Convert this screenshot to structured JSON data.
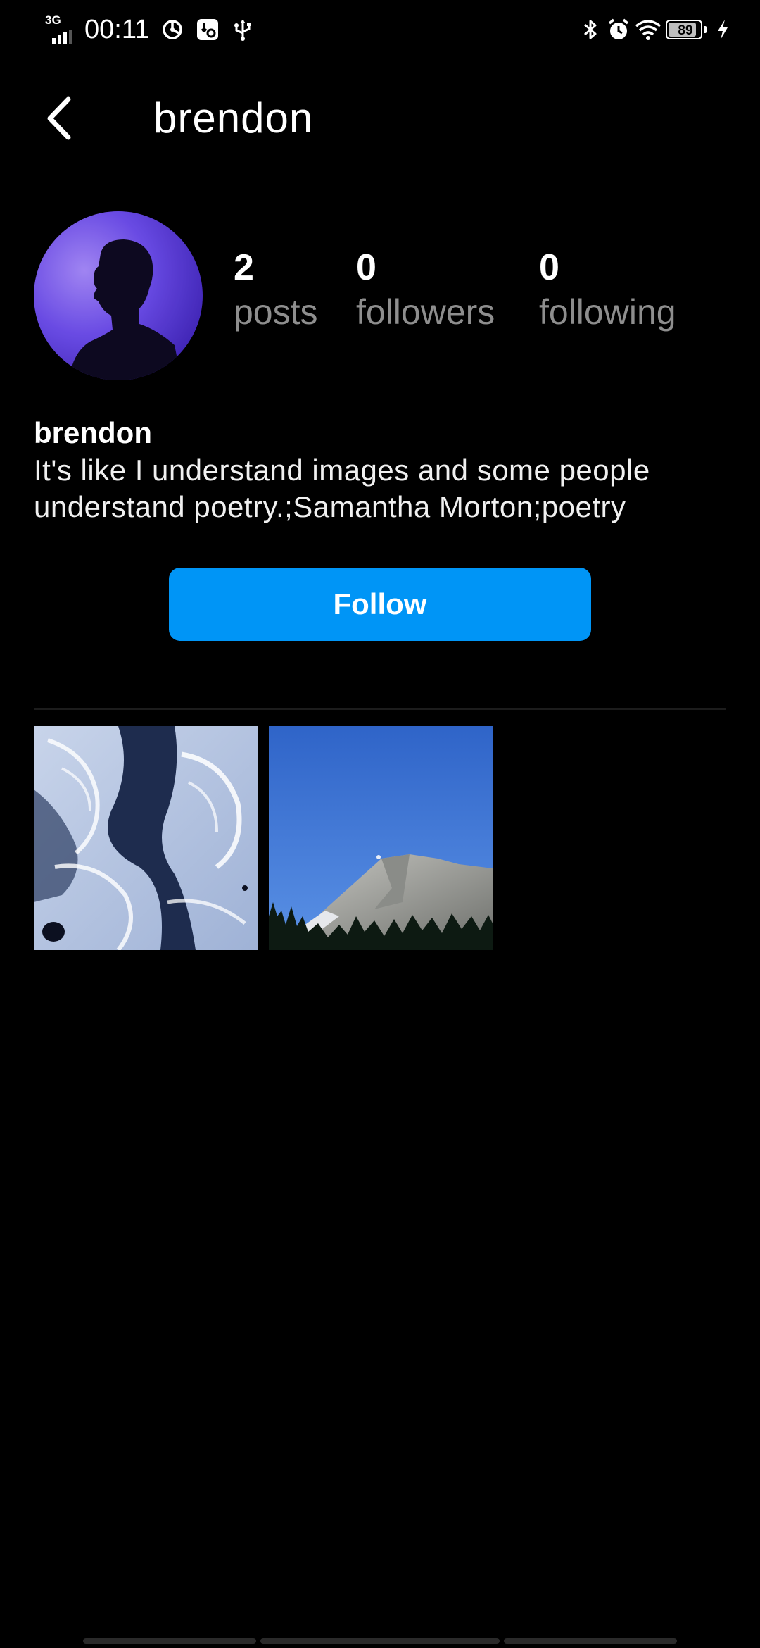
{
  "status_bar": {
    "network_type": "3G",
    "time": "00:11",
    "battery_level": "89",
    "battery_fraction": 0.89,
    "left_icons": [
      "signal-icon",
      "data-saver-icon",
      "usb-debug-icon",
      "usb-icon"
    ],
    "right_icons": [
      "bluetooth-icon",
      "alarm-icon",
      "wifi-icon",
      "battery-icon",
      "charging-icon"
    ]
  },
  "header": {
    "title": "brendon"
  },
  "profile": {
    "stats": [
      {
        "count": "2",
        "label": "posts"
      },
      {
        "count": "0",
        "label": "followers"
      },
      {
        "count": "0",
        "label": "following"
      }
    ],
    "name": "brendon",
    "bio": "It's like I understand images and some people understand poetry.;Samantha Morton;poetry",
    "follow_label": "Follow"
  },
  "posts": [
    {
      "name": "post-thumbnail-ice"
    },
    {
      "name": "post-thumbnail-mountain"
    }
  ],
  "colors": {
    "background": "#000000",
    "accent": "#0095f6",
    "muted_text": "#8e8e8e"
  }
}
